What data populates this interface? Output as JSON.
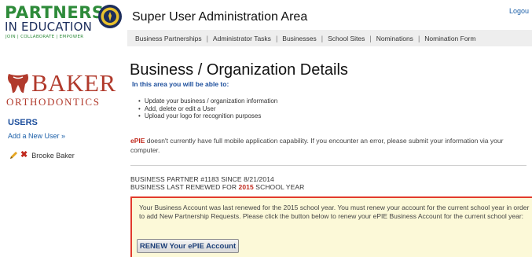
{
  "header": {
    "logo_line1": "PARTNERS",
    "logo_line2": "IN EDUCATION",
    "logo_tagline": "JOIN | COLLABORATE | EMPOWER",
    "title": "Super User Administration Area",
    "logout": "Logou"
  },
  "nav": {
    "items": [
      {
        "label": "Business Partnerships"
      },
      {
        "label": "Administrator Tasks"
      },
      {
        "label": "Businesses"
      },
      {
        "label": "School Sites"
      },
      {
        "label": "Nominations"
      },
      {
        "label": "Nomination Form"
      }
    ],
    "separator": "|"
  },
  "sidebar": {
    "company_name": "BAKER",
    "company_subtitle": "ORTHODONTICS",
    "users_heading": "USERS",
    "add_user": "Add a New User »",
    "users": [
      {
        "name": "Brooke Baker"
      }
    ]
  },
  "main": {
    "title": "Business / Organization Details",
    "intro": "In this area you will be able to:",
    "bullets": [
      "Update your business / organization information",
      "Add, delete or edit a User",
      "Upload your logo for recognition purposes"
    ],
    "notice_brand": "ePIE",
    "notice_text": " doesn't currently have full mobile application capability. If you encounter an error, please submit your information via your computer.",
    "partner_line": "BUSINESS PARTNER #1183 SINCE 8/21/2014",
    "renew_prefix": "BUSINESS LAST RENEWED FOR ",
    "renew_year": "2015",
    "renew_suffix": " SCHOOL YEAR",
    "alert_text": "Your Business Account was last renewed for the 2015 school year.  You must renew your account for the current school year in order to add New Partnership Requests.  Please click the button below to renew your ePIE Business Account for the current school year:",
    "renew_button": "RENEW Your ePIE Account"
  },
  "colors": {
    "partners_green": "#2e8b3a",
    "partners_navy": "#1c2d5c",
    "brand_red": "#b13a2c",
    "link_blue": "#1a5ea8",
    "alert_border": "#e23b2c",
    "alert_background": "#fcf9d8"
  }
}
